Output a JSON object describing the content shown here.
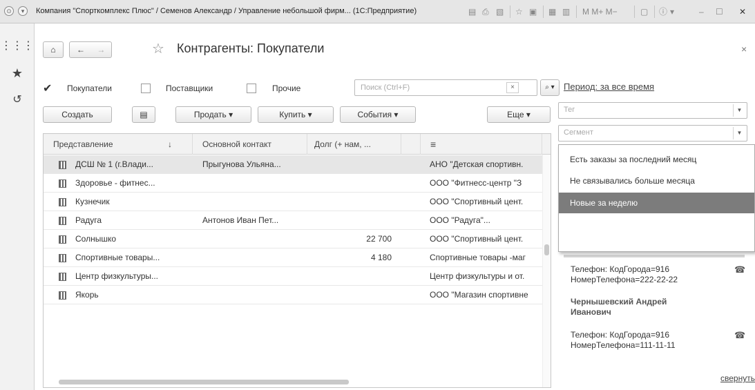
{
  "window": {
    "title": "Компания \"Спорткомплекс Плюс\" / Семенов Александр / Управление небольшой фирм... (1С:Предприятие)",
    "toolbar_text": "M  M+  M−"
  },
  "page": {
    "title": "Контрагенты: Покупатели",
    "close_glyph": "×"
  },
  "filters": {
    "buyers_label": "Покупатели",
    "buyers_checked": true,
    "suppliers_label": "Поставщики",
    "others_label": "Прочие",
    "search_placeholder": "Поиск (Ctrl+F)",
    "search_clear": "×",
    "search_btn": "⌕ ▾"
  },
  "toolbar": {
    "create": "Создать",
    "sell": "Продать",
    "buy": "Купить",
    "events": "События",
    "more": "Еще"
  },
  "sidebar": {
    "period_link": "Период: за все время",
    "tag_placeholder": "Тег",
    "segment_placeholder": "Сегмент",
    "segment_options": [
      "Есть заказы за последний месяц",
      "Не связывались больше месяца",
      "Новые за неделю"
    ],
    "highlighted_index": 2,
    "collapse_link": "свернуть",
    "contacts": [
      {
        "phone_line1": "Телефон: КодГорода=916",
        "phone_line2": "НомерТелефона=222-22-22"
      },
      {
        "name_line1": "Чернышевский Андрей",
        "name_line2": "Иванович",
        "phone_line1": "Телефон: КодГорода=916",
        "phone_line2": "НомерТелефона=111-11-11"
      }
    ]
  },
  "table": {
    "columns": [
      "Представление",
      "Основной контакт",
      "Долг (+ нам, ...",
      "",
      "≡"
    ],
    "sort_glyph": "↓",
    "rows": [
      {
        "name": "ДСШ № 1 (г.Влади...",
        "contact": "Прыгунова Ульяна...",
        "debt": "",
        "full": "АНО \"Детская спортивн."
      },
      {
        "name": "Здоровье - фитнес...",
        "contact": "",
        "debt": "",
        "full": "ООО \"Фитнесс-центр \"З"
      },
      {
        "name": "Кузнечик",
        "contact": "",
        "debt": "",
        "full": "ООО \"Спортивный цент."
      },
      {
        "name": "Радуга",
        "contact": "Антонов Иван Пет...",
        "debt": "",
        "full": "ООО \"Радуга\"..."
      },
      {
        "name": "Солнышко",
        "contact": "",
        "debt": "22 700",
        "full": "ООО \"Спортивный цент."
      },
      {
        "name": "Спортивные товары...",
        "contact": "",
        "debt": "4 180",
        "full": "Спортивные товары -маг"
      },
      {
        "name": "Центр физкультуры...",
        "contact": "",
        "debt": "",
        "full": "Центр физкультуры и от."
      },
      {
        "name": "Якорь",
        "contact": "",
        "debt": "",
        "full": "ООО \"Магазин спортивне"
      }
    ]
  }
}
